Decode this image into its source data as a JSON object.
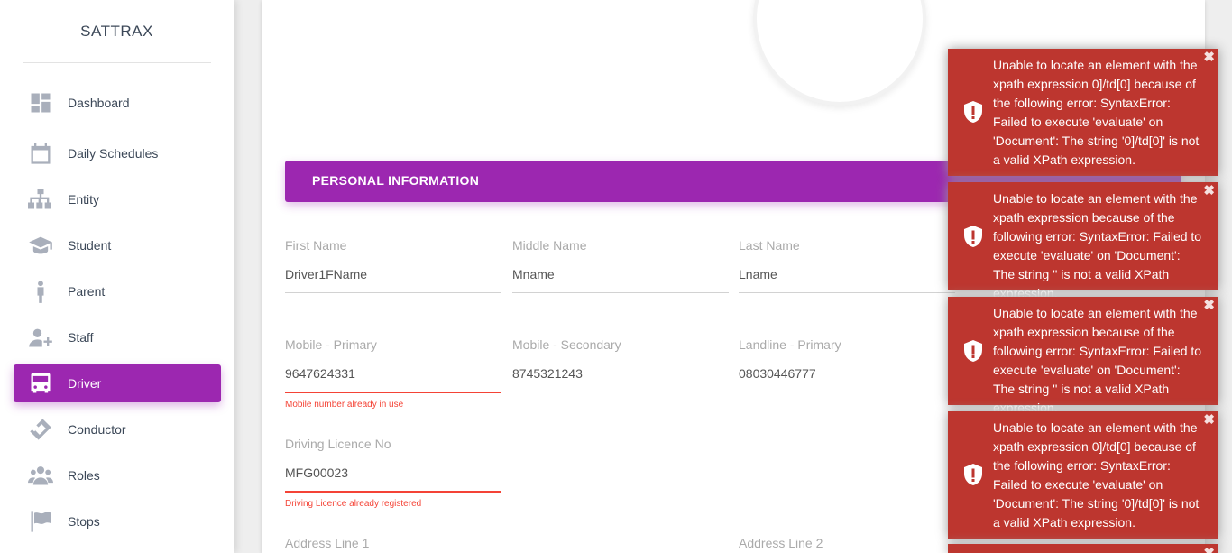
{
  "sidebar": {
    "brand": "SATTRAX",
    "items": [
      {
        "label": "Dashboard",
        "icon": "dashboard-icon",
        "active": false
      },
      {
        "label": "Daily Schedules",
        "icon": "calendar-icon",
        "active": false
      },
      {
        "label": "Entity",
        "icon": "sitemap-icon",
        "active": false
      },
      {
        "label": "Student",
        "icon": "graduation-cap-icon",
        "active": false
      },
      {
        "label": "Parent",
        "icon": "person-icon",
        "active": false
      },
      {
        "label": "Staff",
        "icon": "user-plus-icon",
        "active": false
      },
      {
        "label": "Driver",
        "icon": "bus-icon",
        "active": true
      },
      {
        "label": "Conductor",
        "icon": "ticket-icon",
        "active": false
      },
      {
        "label": "Roles",
        "icon": "users-icon",
        "active": false
      },
      {
        "label": "Stops",
        "icon": "flag-icon",
        "active": false
      }
    ]
  },
  "main": {
    "section_title": "PERSONAL INFORMATION",
    "fields": {
      "first_name": {
        "label": "First Name",
        "value": "Driver1FName"
      },
      "middle_name": {
        "label": "Middle Name",
        "value": "Mname"
      },
      "last_name": {
        "label": "Last Name",
        "value": "Lname"
      },
      "mobile_primary": {
        "label": "Mobile - Primary",
        "value": "9647624331",
        "error": "Mobile number already in use"
      },
      "mobile_secondary": {
        "label": "Mobile - Secondary",
        "value": "8745321243"
      },
      "landline_primary": {
        "label": "Landline - Primary",
        "value": "08030446777"
      },
      "driving_licence": {
        "label": "Driving Licence No",
        "value": "MFG00023",
        "error": "Driving Licence already registered"
      },
      "address_line_1": {
        "label": "Address Line 1"
      },
      "address_line_2": {
        "label": "Address Line 2"
      }
    }
  },
  "toasts": [
    {
      "message": "Unable to locate an element with the xpath expression 0]/td[0] because of the following error: SyntaxError: Failed to execute 'evaluate' on 'Document': The string '0]/td[0]' is not a valid XPath expression."
    },
    {
      "message": "Unable to locate an element with the xpath expression because of the following error: SyntaxError: Failed to execute 'evaluate' on 'Document': The string '' is not a valid XPath expression."
    },
    {
      "message": "Unable to locate an element with the xpath expression because of the following error: SyntaxError: Failed to execute 'evaluate' on 'Document': The string '' is not a valid XPath expression."
    },
    {
      "message": "Unable to locate an element with the xpath expression 0]/td[0] because of the following error: SyntaxError: Failed to execute 'evaluate' on 'Document': The string '0]/td[0]' is not a valid XPath expression."
    }
  ],
  "colors": {
    "accent": "#9c27b0",
    "error": "#f44336",
    "toast": "#bd362f"
  }
}
